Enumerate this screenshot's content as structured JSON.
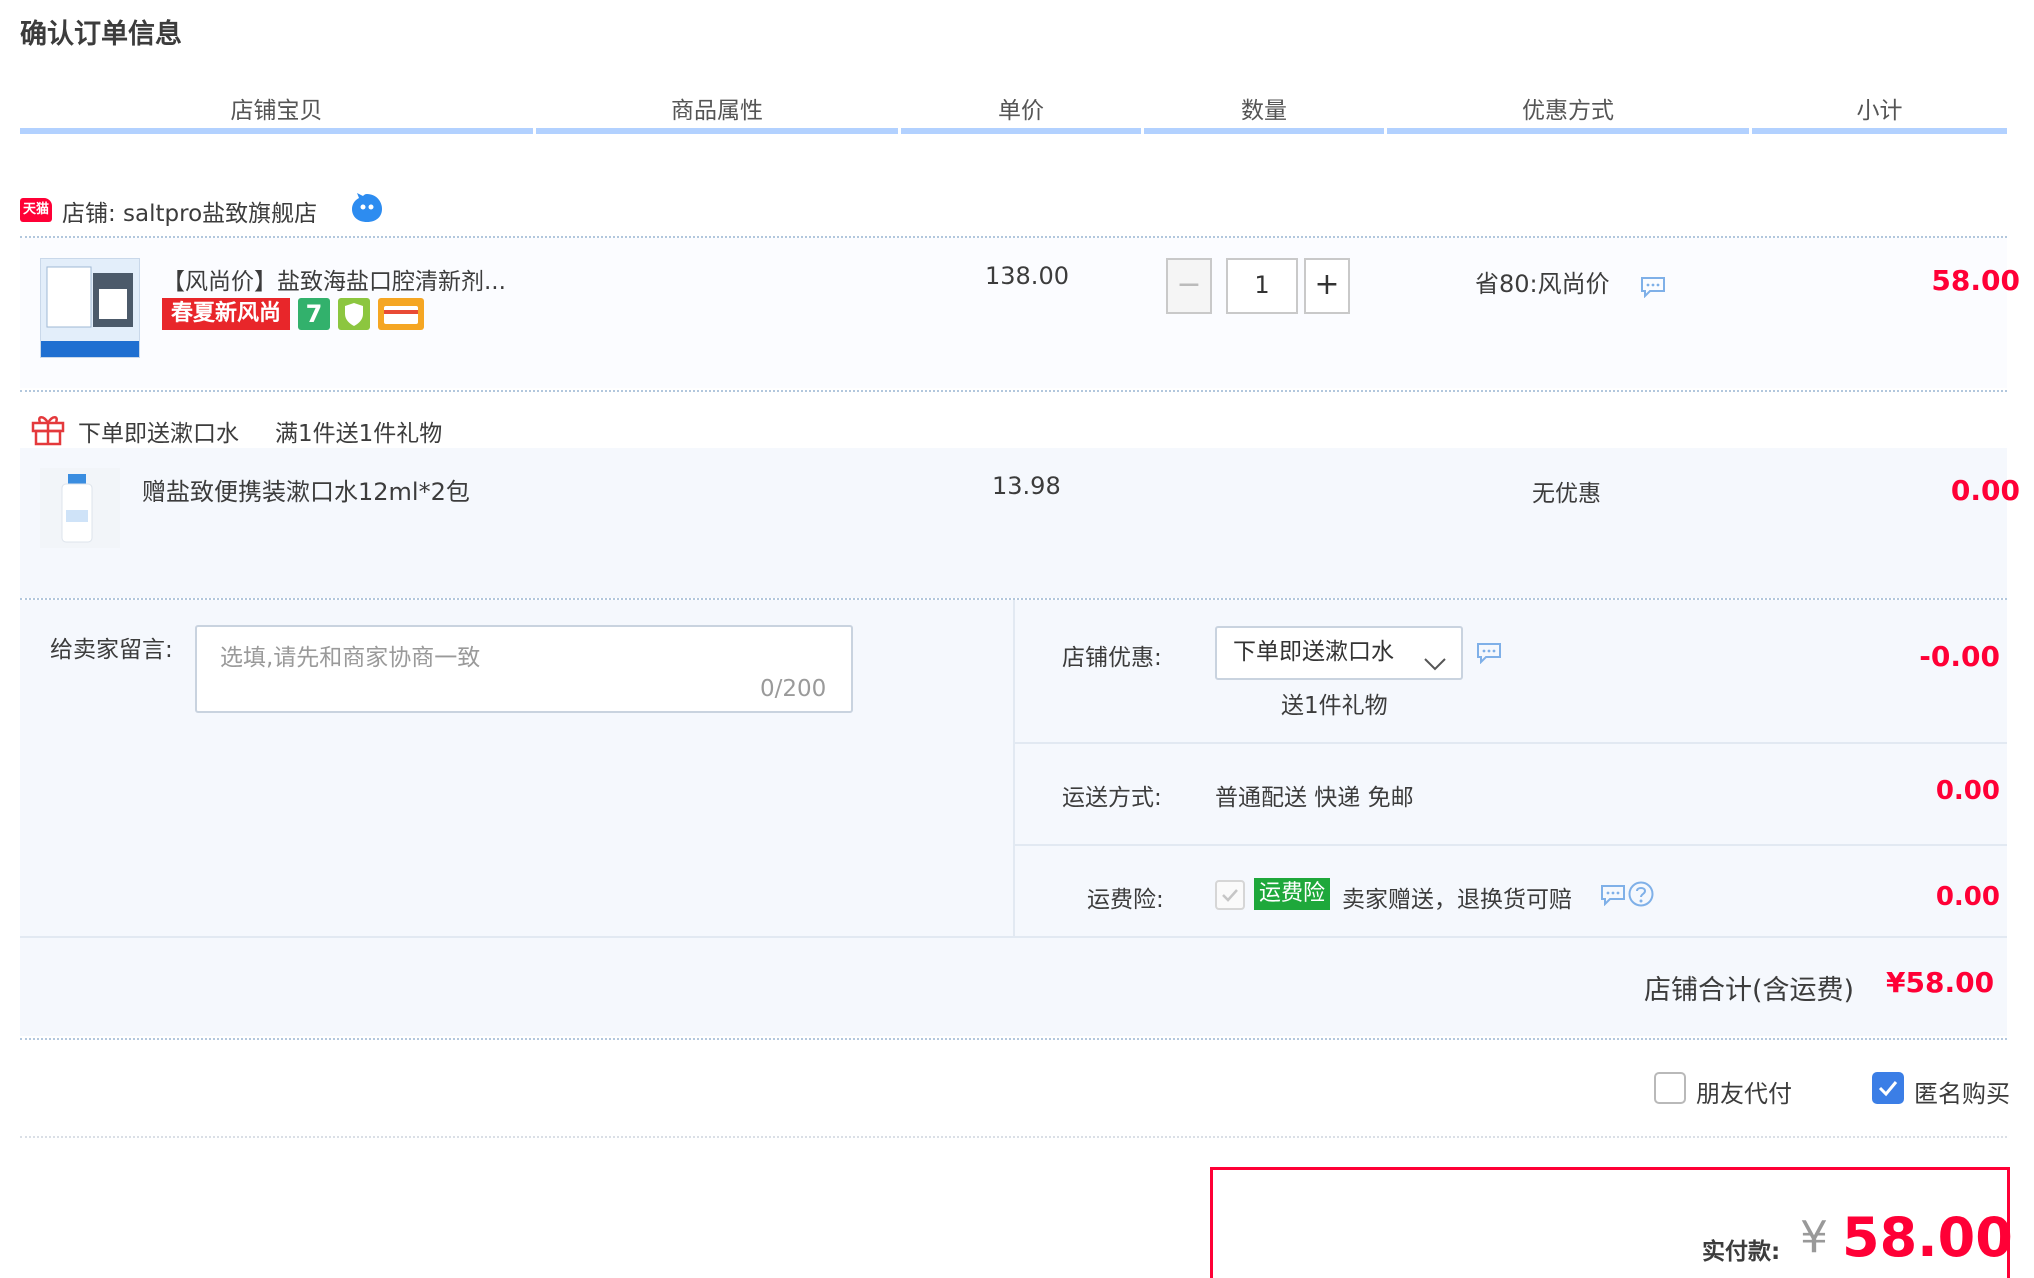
{
  "page_title": "确认订单信息",
  "columns": [
    "店铺宝贝",
    "商品属性",
    "单价",
    "数量",
    "优惠方式",
    "小计"
  ],
  "shop": {
    "label": "店铺: saltpro盐致旗舰店",
    "tmall_badge": "天猫"
  },
  "product": {
    "title": "【风尚价】盐致海盐口腔清新剂...",
    "badge_spring": "春夏新风尚",
    "badge_seven": "7",
    "unit_price": "138.00",
    "quantity": "1",
    "discount": "省80:风尚价",
    "subtotal": "58.00"
  },
  "gift": {
    "label": "下单即送漱口水",
    "rule": "满1件送1件礼物",
    "title": "赠盐致便携装漱口水12ml*2包",
    "unit_price": "13.98",
    "discount": "无优惠",
    "subtotal": "0.00"
  },
  "remark": {
    "label": "给卖家留言:",
    "placeholder": "选填,请先和商家协商一致",
    "count": "0/200"
  },
  "coupon": {
    "label": "店铺优惠:",
    "selected": "下单即送漱口水",
    "sub": "送1件礼物",
    "value": "-0.00"
  },
  "shipping": {
    "label": "运送方式:",
    "value": "普通配送 快递 免邮",
    "amount": "0.00"
  },
  "insurance": {
    "label": "运费险:",
    "badge": "运费险",
    "text": "卖家赠送，退换货可赔",
    "amount": "0.00"
  },
  "shop_total": {
    "label": "店铺合计(含运费)",
    "value": "¥58.00"
  },
  "options": {
    "friend_pay": "朋友代付",
    "anonymous": "匿名购买"
  },
  "payment": {
    "label": "实付款:",
    "currency": "¥",
    "amount": "58.00"
  },
  "colors": {
    "accent_red": "#ff0036",
    "header_border": "#b2d1ff",
    "checkbox_blue": "#3b7ee6",
    "insurance_green": "#1ea83b"
  }
}
